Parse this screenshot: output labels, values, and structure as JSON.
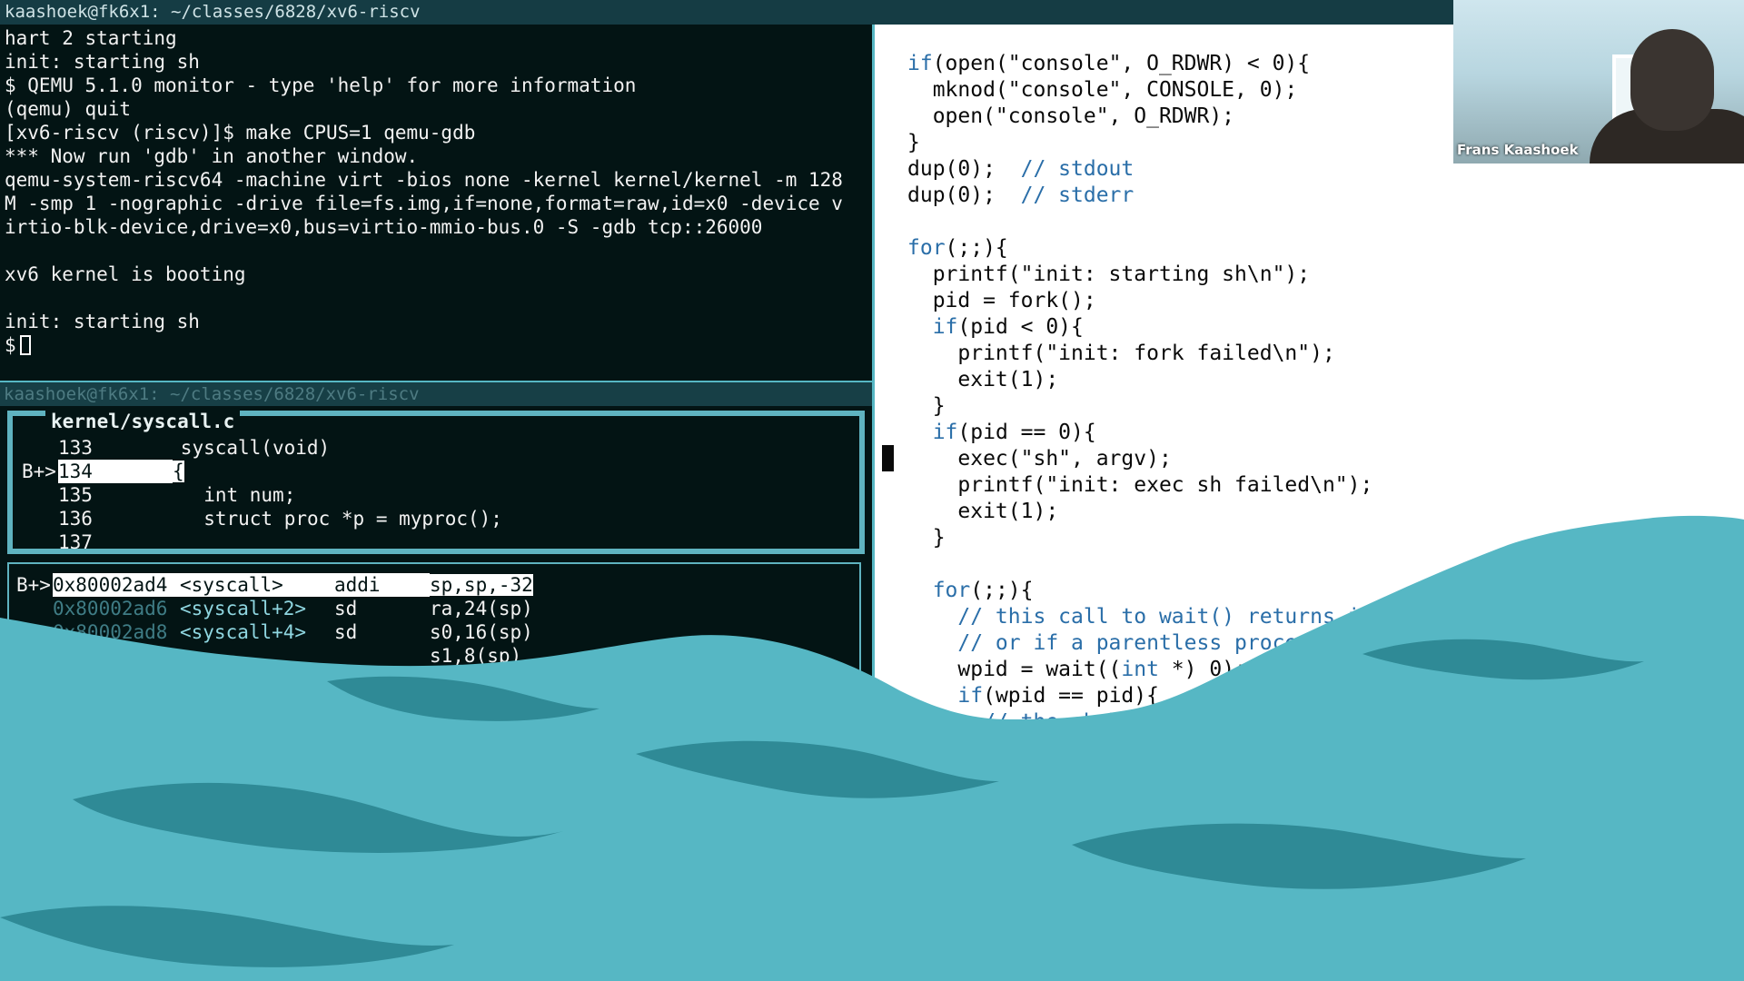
{
  "titlebar": {
    "title": "kaashoek@fk6x1: ~/classes/6828/xv6-riscv"
  },
  "terminal_top": {
    "lines": [
      "hart 2 starting",
      "init: starting sh",
      "$ QEMU 5.1.0 monitor - type 'help' for more information",
      "(qemu) quit",
      "[xv6-riscv (riscv)]$ make CPUS=1 qemu-gdb",
      "*** Now run 'gdb' in another window.",
      "qemu-system-riscv64 -machine virt -bios none -kernel kernel/kernel -m 128",
      "M -smp 1 -nographic -drive file=fs.img,if=none,format=raw,id=x0 -device v",
      "irtio-blk-device,drive=x0,bus=virtio-mmio-bus.0 -S -gdb tcp::26000",
      "",
      "xv6 kernel is booting",
      "",
      "init: starting sh"
    ],
    "prompt": "$"
  },
  "terminal_gdb": {
    "title": "kaashoek@fk6x1: ~/classes/6828/xv6-riscv",
    "source_file": "kernel/syscall.c",
    "source_lines": [
      {
        "bp": "",
        "num": "133",
        "text": "syscall(void)",
        "indent": "    "
      },
      {
        "bp": "B+>",
        "num": "134",
        "text": "{",
        "indent": "    "
      },
      {
        "bp": "",
        "num": "135",
        "text": "int num;",
        "indent": "      "
      },
      {
        "bp": "",
        "num": "136",
        "text": "struct proc *p = myproc();",
        "indent": "      "
      },
      {
        "bp": "",
        "num": "137",
        "text": "",
        "indent": ""
      }
    ],
    "asm_lines": [
      {
        "bp": "B+>",
        "addr": "0x80002ad4",
        "sym": "<syscall>",
        "op": "addi",
        "args": "sp,sp,-32"
      },
      {
        "bp": "",
        "addr": "0x80002ad6",
        "sym": "<syscall+2>",
        "op": "sd",
        "args": "ra,24(sp)"
      },
      {
        "bp": "",
        "addr": "0x80002ad8",
        "sym": "<syscall+4>",
        "op": "sd",
        "args": "s0,16(sp)"
      },
      {
        "bp": "",
        "addr": "",
        "sym": "",
        "op": "",
        "args": "s1,8(sp)"
      }
    ]
  },
  "editor": {
    "lines": [
      [
        {
          "t": "if",
          "c": "kw"
        },
        {
          "t": "(open(\"console\", O_RDWR) < 0){",
          "c": ""
        }
      ],
      [
        {
          "t": "  mknod(\"console\", CONSOLE, 0);",
          "c": ""
        }
      ],
      [
        {
          "t": "  open(\"console\", O_RDWR);",
          "c": ""
        }
      ],
      [
        {
          "t": "}",
          "c": ""
        }
      ],
      [
        {
          "t": "dup(0);  ",
          "c": ""
        },
        {
          "t": "// stdout",
          "c": "cm"
        }
      ],
      [
        {
          "t": "dup(0);  ",
          "c": ""
        },
        {
          "t": "// stderr",
          "c": "cm"
        }
      ],
      [
        {
          "t": "",
          "c": ""
        }
      ],
      [
        {
          "t": "for",
          "c": "kw"
        },
        {
          "t": "(;;){",
          "c": ""
        }
      ],
      [
        {
          "t": "  printf(\"init: starting sh\\n\");",
          "c": ""
        }
      ],
      [
        {
          "t": "  pid = fork();",
          "c": ""
        }
      ],
      [
        {
          "t": "  ",
          "c": ""
        },
        {
          "t": "if",
          "c": "kw"
        },
        {
          "t": "(pid < 0){",
          "c": ""
        }
      ],
      [
        {
          "t": "    printf(\"init: fork failed\\n\");",
          "c": ""
        }
      ],
      [
        {
          "t": "    exit(1);",
          "c": ""
        }
      ],
      [
        {
          "t": "  }",
          "c": ""
        }
      ],
      [
        {
          "t": "  ",
          "c": ""
        },
        {
          "t": "if",
          "c": "kw"
        },
        {
          "t": "(pid == 0){",
          "c": ""
        }
      ],
      [
        {
          "t": "    exec(\"sh\", argv);",
          "c": ""
        }
      ],
      [
        {
          "t": "    printf(\"init: exec sh failed\\n\");",
          "c": ""
        }
      ],
      [
        {
          "t": "    exit(1);",
          "c": ""
        }
      ],
      [
        {
          "t": "  }",
          "c": ""
        }
      ],
      [
        {
          "t": "",
          "c": ""
        }
      ],
      [
        {
          "t": "  ",
          "c": ""
        },
        {
          "t": "for",
          "c": "kw"
        },
        {
          "t": "(;;){",
          "c": ""
        }
      ],
      [
        {
          "t": "    ",
          "c": ""
        },
        {
          "t": "// this call to wait() returns if the sh",
          "c": "cm"
        }
      ],
      [
        {
          "t": "    ",
          "c": ""
        },
        {
          "t": "// or if a parentless process exits",
          "c": "cm"
        }
      ],
      [
        {
          "t": "    wpid = wait((",
          "c": ""
        },
        {
          "t": "int",
          "c": "kw"
        },
        {
          "t": " *) 0);",
          "c": ""
        }
      ],
      [
        {
          "t": "    ",
          "c": ""
        },
        {
          "t": "if",
          "c": "kw"
        },
        {
          "t": "(wpid == pid){",
          "c": ""
        }
      ],
      [
        {
          "t": "      ",
          "c": ""
        },
        {
          "t": "// the shell",
          "c": "cm"
        }
      ]
    ]
  },
  "webcam": {
    "name": "Frans Kaashoek"
  },
  "colors": {
    "wave": "#56b7c4",
    "wave_dark": "#2f8a96",
    "terminal_bg": "#031414",
    "keyword": "#2a6ea8"
  }
}
